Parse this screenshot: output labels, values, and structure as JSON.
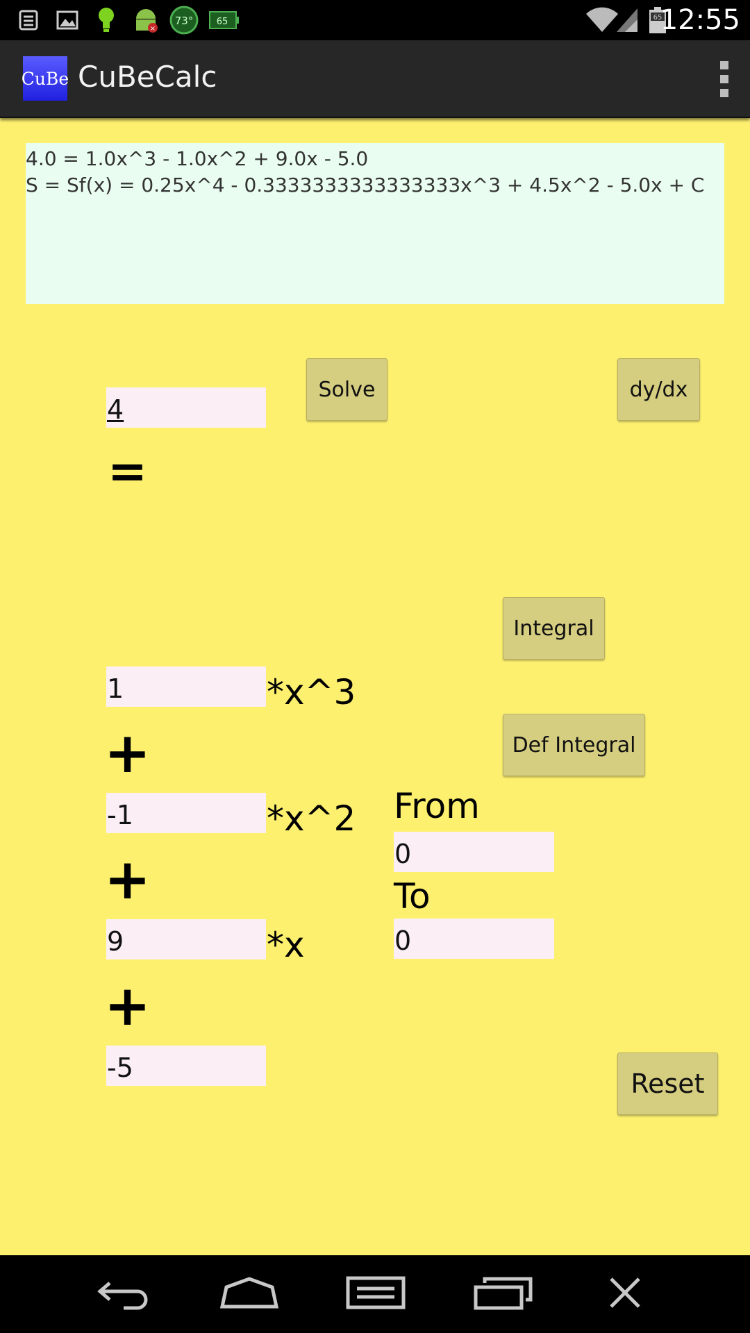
{
  "status_bar": {
    "time": "12:55",
    "temp_badge": "73°",
    "battery_badge": "65",
    "sim_badge": "65",
    "icons": [
      "notes-icon",
      "image-icon",
      "bulb-icon",
      "android-debug-icon",
      "temperature-icon",
      "battery-app-icon",
      "wifi-icon",
      "signal-icon",
      "sim-battery-icon"
    ]
  },
  "action_bar": {
    "logo_text": "CuBe",
    "title": "CuBeCalc",
    "overflow_icon": "overflow-menu-icon"
  },
  "output": {
    "line1": "4.0 = 1.0x^3 - 1.0x^2 + 9.0x - 5.0",
    "line2": "S = Sf(x) = 0.25x^4 - 0.3333333333333333x^3 + 4.5x^2 - 5.0x + C"
  },
  "equation": {
    "result_value": "4",
    "equals_sign": "=",
    "coef_x3": "1",
    "term_x3": "*x^3",
    "coef_x2": "-1",
    "term_x2": "*x^2",
    "coef_x": "9",
    "term_x": "*x",
    "constant": "-5",
    "plus": "+"
  },
  "buttons": {
    "solve": "Solve",
    "derivative": "dy/dx",
    "integral": "Integral",
    "def_integral": "Def Integral",
    "reset": "Reset"
  },
  "bounds": {
    "from_label": "From",
    "from_value": "0",
    "to_label": "To",
    "to_value": "0"
  },
  "nav_bar": {
    "icons": [
      "back-icon",
      "home-icon",
      "menu-icon",
      "recent-apps-icon",
      "close-icon"
    ]
  },
  "colors": {
    "background": "#fdf06f",
    "output_bg": "#e9fef0",
    "input_bg": "#fbeff5",
    "button_bg": "#d5cd80",
    "logo_blue": "#3a3af0"
  }
}
